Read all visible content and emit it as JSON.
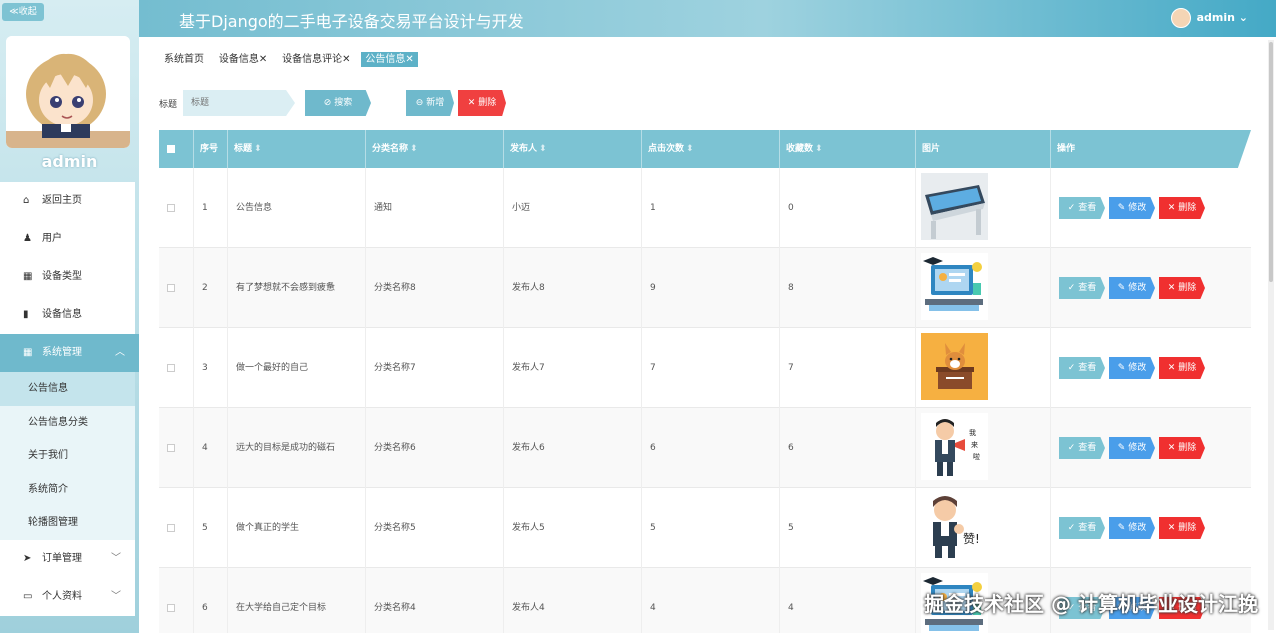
{
  "sidebar": {
    "collapse_label": "≪收起",
    "username": "admin",
    "menu": [
      {
        "label": "返回主页",
        "icon": "home-icon"
      },
      {
        "label": "用户",
        "icon": "user-icon"
      },
      {
        "label": "设备类型",
        "icon": "grid-icon"
      },
      {
        "label": "设备信息",
        "icon": "device-icon"
      },
      {
        "label": "系统管理",
        "icon": "grid-icon"
      }
    ],
    "system_sub": [
      "公告信息",
      "公告信息分类",
      "关于我们",
      "系统简介",
      "轮播图管理"
    ],
    "menu_bottom": [
      {
        "label": "订单管理",
        "icon": "send-icon"
      },
      {
        "label": "个人资料",
        "icon": "card-icon"
      }
    ]
  },
  "header": {
    "title": "基于Django的二手电子设备交易平台设计与开发",
    "user": "admin"
  },
  "tabs": [
    {
      "label": "系统首页",
      "closable": false
    },
    {
      "label": "设备信息",
      "closable": true
    },
    {
      "label": "设备信息评论",
      "closable": true
    },
    {
      "label": "公告信息",
      "closable": true
    }
  ],
  "search": {
    "label": "标题",
    "placeholder": "标题",
    "search_btn": "⊘ 搜索",
    "add_btn": "⊖ 新增",
    "delete_btn": "✕ 删除"
  },
  "table": {
    "columns": [
      "序号",
      "标题",
      "分类名称",
      "发布人",
      "点击次数",
      "收藏数",
      "图片",
      "操作"
    ],
    "rows": [
      {
        "no": "1",
        "title": "公告信息",
        "category": "通知",
        "publisher": "小迈",
        "clicks": "1",
        "favorites": "0",
        "image": "tablet-device"
      },
      {
        "no": "2",
        "title": "有了梦想就不会感到疲惫",
        "category": "分类名称8",
        "publisher": "发布人8",
        "clicks": "9",
        "favorites": "8",
        "image": "study-illustration"
      },
      {
        "no": "3",
        "title": "做一个最好的自己",
        "category": "分类名称7",
        "publisher": "发布人7",
        "clicks": "7",
        "favorites": "7",
        "image": "corgi"
      },
      {
        "no": "4",
        "title": "远大的目标是成功的磁石",
        "category": "分类名称6",
        "publisher": "发布人6",
        "clicks": "6",
        "favorites": "6",
        "image": "man-megaphone"
      },
      {
        "no": "5",
        "title": "做个真正的学生",
        "category": "分类名称5",
        "publisher": "发布人5",
        "clicks": "5",
        "favorites": "5",
        "image": "man-thumbs"
      },
      {
        "no": "6",
        "title": "在大学给自己定个目标",
        "category": "分类名称4",
        "publisher": "发布人4",
        "clicks": "4",
        "favorites": "4",
        "image": "study-illustration"
      }
    ],
    "action_view": "✓ 查看",
    "action_edit": "✎ 修改",
    "action_delete": "✕ 删除"
  },
  "watermark": "掘金技术社区 @ 计算机毕业设计江挽"
}
